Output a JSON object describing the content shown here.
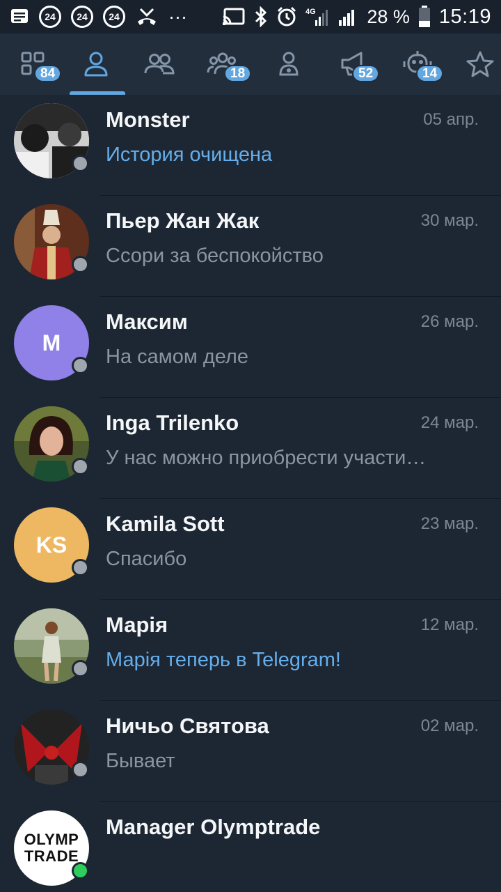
{
  "status_bar": {
    "icons_left": [
      "message-icon",
      "channel-24-icon",
      "channel-24-icon",
      "channel-24-icon",
      "missed-call-icon",
      "more-dots-icon"
    ],
    "badge_24": "24",
    "more": "···",
    "battery_percent": "28 %",
    "time": "15:19",
    "network": "4G"
  },
  "tabs": [
    {
      "icon": "all-chats-icon",
      "badge": "84"
    },
    {
      "icon": "person-icon",
      "badge": ""
    },
    {
      "icon": "contacts-icon",
      "badge": ""
    },
    {
      "icon": "groups-icon",
      "badge": "18"
    },
    {
      "icon": "secret-user-icon",
      "badge": ""
    },
    {
      "icon": "channel-megaphone-icon",
      "badge": "52"
    },
    {
      "icon": "bot-icon",
      "badge": "14"
    },
    {
      "icon": "star-icon",
      "badge": ""
    }
  ],
  "colors": {
    "accent": "#62a7e0",
    "background": "#1d2733",
    "online": "#2fce5c"
  },
  "chats": [
    {
      "name": "Monster",
      "date": "05 апр.",
      "preview": "История очищена",
      "preview_type": "service",
      "avatar_type": "photo",
      "online": false
    },
    {
      "name": "Пьер Жан Жак",
      "date": "30 мар.",
      "preview": "Ссори за беспокойство",
      "preview_type": "text",
      "avatar_type": "photo",
      "online": false
    },
    {
      "name": "Максим",
      "date": "26 мар.",
      "preview": "На самом деле",
      "preview_type": "text",
      "avatar_type": "initials",
      "initials": "M",
      "avatar_color": "#8f81e8",
      "online": false
    },
    {
      "name": "Inga Trilenko",
      "date": "24 мар.",
      "preview": "У нас можно приобрести участи…",
      "preview_type": "text",
      "avatar_type": "photo",
      "online": false
    },
    {
      "name": "Kamila Sott",
      "date": "23 мар.",
      "preview": "Спасибо",
      "preview_type": "text",
      "avatar_type": "initials",
      "initials": "KS",
      "avatar_color": "#eeb863",
      "online": false
    },
    {
      "name": "Марія",
      "date": "12 мар.",
      "preview": "Марія теперь в Telegram!",
      "preview_type": "service",
      "avatar_type": "photo",
      "online": false
    },
    {
      "name": "Ничьо Святова",
      "date": "02 мар.",
      "preview": "Бывает",
      "preview_type": "text",
      "avatar_type": "photo",
      "online": false
    },
    {
      "name": "Manager Olymptrade",
      "date": "",
      "preview": "",
      "preview_type": "text",
      "avatar_type": "logo",
      "logo_text": [
        "OLYMP",
        "TRADE"
      ],
      "online": true
    }
  ]
}
